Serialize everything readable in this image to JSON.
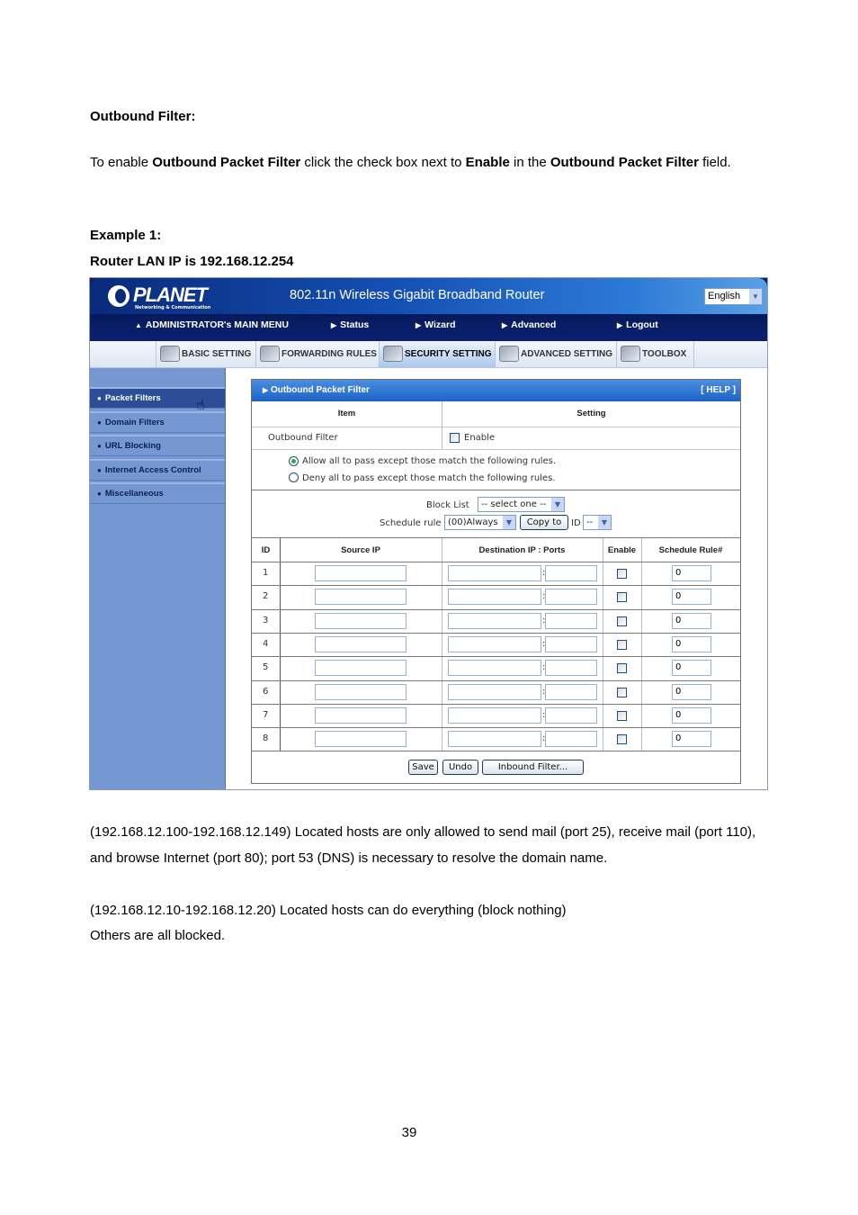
{
  "document": {
    "heading": "Outbound Filter:",
    "intro": [
      {
        "text": "To enable ",
        "bold": false
      },
      {
        "text": "Outbound Packet Filter",
        "bold": true
      },
      {
        "text": " click the check box next to ",
        "bold": false
      },
      {
        "text": "Enable",
        "bold": true
      },
      {
        "text": " in the ",
        "bold": false
      },
      {
        "text": "Outbound Packet Filter",
        "bold": true
      },
      {
        "text": " field.",
        "bold": false
      }
    ],
    "example_label": "Example 1:",
    "lan_ip_label": "Router LAN IP is 192.168.12.254",
    "desc1": "(192.168.12.100-192.168.12.149) Located hosts are only allowed to send mail (port 25), receive mail (port 110), and browse Internet (port 80); port 53 (DNS) is necessary to resolve the domain name.",
    "desc2": "(192.168.12.10-192.168.12.20) Located hosts can do everything (block nothing)",
    "desc3": "Others are all blocked.",
    "page_number": "39"
  },
  "router": {
    "logo_text": "PLANET",
    "logo_subtext": "Networking & Communication",
    "product_title": "802.11n Wireless Gigabit Broadband Router",
    "language": "English",
    "main_menu": [
      {
        "label": "ADMINISTRATOR's MAIN MENU",
        "icon": "user-icon"
      },
      {
        "label": "Status",
        "icon": "arrow-right-icon"
      },
      {
        "label": "Wizard",
        "icon": "arrow-right-icon"
      },
      {
        "label": "Advanced",
        "icon": "arrow-right-icon"
      },
      {
        "label": "Logout",
        "icon": "arrow-right-icon"
      }
    ],
    "tabs": [
      {
        "label": "BASIC SETTING",
        "icon": "folder-icon",
        "active": false
      },
      {
        "label": "FORWARDING RULES",
        "icon": "forwarding-icon",
        "active": false
      },
      {
        "label": "SECURITY SETTING",
        "icon": "lock-icon",
        "active": true
      },
      {
        "label": "ADVANCED SETTING",
        "icon": "advanced-icon",
        "active": false
      },
      {
        "label": "TOOLBOX",
        "icon": "toolbox-icon",
        "active": false
      }
    ],
    "sidebar": [
      {
        "label": "Packet Filters",
        "active": true
      },
      {
        "label": "Domain Filters",
        "active": false
      },
      {
        "label": "URL Blocking",
        "active": false
      },
      {
        "label": "Internet Access Control",
        "active": false
      },
      {
        "label": "Miscellaneous",
        "active": false
      }
    ],
    "panel": {
      "title": "Outbound Packet Filter",
      "help": "[ HELP ]",
      "col_item": "Item",
      "col_setting": "Setting",
      "filter_label": "Outbound Filter",
      "enable_label": "Enable",
      "enable_checked": false,
      "radio_allow": "Allow all to pass except those match the following rules.",
      "radio_deny": "Deny all to pass except those match the following rules.",
      "radio_selected": "allow",
      "block_list_label": "Block List",
      "block_list_value": "-- select one --",
      "schedule_rule_label": "Schedule rule",
      "schedule_rule_value": "(00)Always",
      "copy_to_label": "Copy to",
      "id_label": "ID",
      "id_value": "--",
      "table_headers": [
        "ID",
        "Source IP",
        "Destination IP : Ports",
        "Enable",
        "Schedule Rule#"
      ],
      "rows": [
        {
          "id": "1",
          "source_ip": "",
          "dest_ip": "",
          "ports": "",
          "enabled": false,
          "schedule": "0"
        },
        {
          "id": "2",
          "source_ip": "",
          "dest_ip": "",
          "ports": "",
          "enabled": false,
          "schedule": "0"
        },
        {
          "id": "3",
          "source_ip": "",
          "dest_ip": "",
          "ports": "",
          "enabled": false,
          "schedule": "0"
        },
        {
          "id": "4",
          "source_ip": "",
          "dest_ip": "",
          "ports": "",
          "enabled": false,
          "schedule": "0"
        },
        {
          "id": "5",
          "source_ip": "",
          "dest_ip": "",
          "ports": "",
          "enabled": false,
          "schedule": "0"
        },
        {
          "id": "6",
          "source_ip": "",
          "dest_ip": "",
          "ports": "",
          "enabled": false,
          "schedule": "0"
        },
        {
          "id": "7",
          "source_ip": "",
          "dest_ip": "",
          "ports": "",
          "enabled": false,
          "schedule": "0"
        },
        {
          "id": "8",
          "source_ip": "",
          "dest_ip": "",
          "ports": "",
          "enabled": false,
          "schedule": "0"
        }
      ],
      "save_label": "Save",
      "undo_label": "Undo",
      "inbound_label": "Inbound Filter..."
    },
    "colors": {
      "banner": "#0b1f6e",
      "sidebar": "#7698d2",
      "sidebar_active": "#2b4e96",
      "panel_header": "#1d62c6"
    }
  }
}
